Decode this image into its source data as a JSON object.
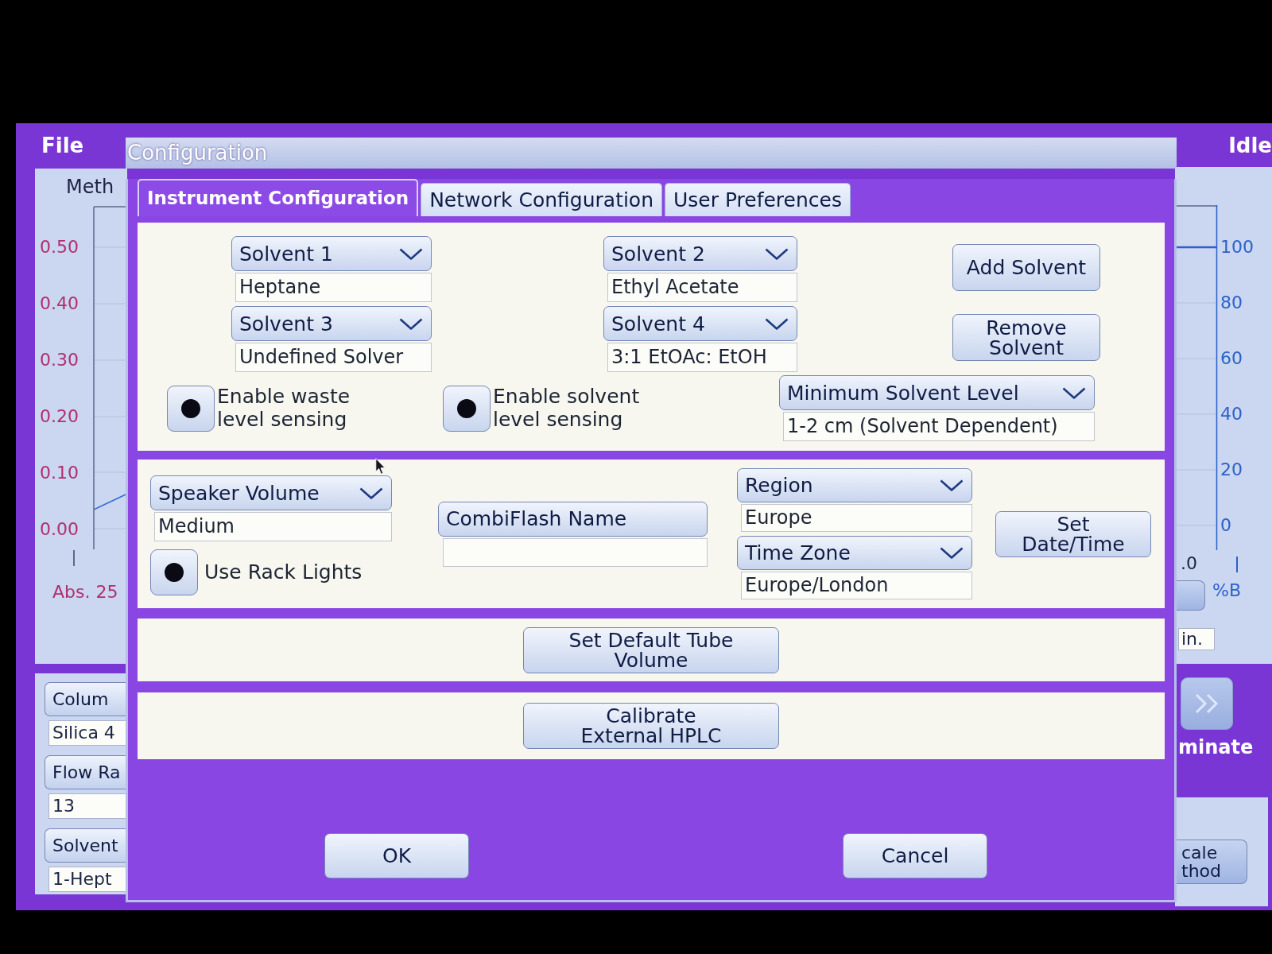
{
  "background_app": {
    "menu_label": "File",
    "status": "Idle",
    "chart": {
      "title": "Meth",
      "left_axis_labels": [
        "0.50",
        "0.40",
        "0.30",
        "0.20",
        "0.10",
        "0.00"
      ],
      "left_axis_title": "Abs. 25",
      "right_axis_labels": [
        "100",
        "80",
        "60",
        "40",
        "20",
        "0"
      ],
      "x_axis_label": ".0",
      "right_axis_title": "%B"
    },
    "settings": [
      {
        "label": "Colum",
        "value": "Silica 4"
      },
      {
        "label": "Flow Ra",
        "value": "13"
      },
      {
        "label": "Solvent",
        "value": "1-Hept"
      }
    ],
    "side_field": "in.",
    "action_label": "minate",
    "side_button": "cale thod"
  },
  "dialog": {
    "title": "Configuration",
    "tabs": [
      {
        "label": "Instrument Configuration",
        "selected": true
      },
      {
        "label": "Network Configuration",
        "selected": false
      },
      {
        "label": "User Preferences",
        "selected": false
      }
    ],
    "solvents": [
      {
        "label": "Solvent 1",
        "value": "Heptane"
      },
      {
        "label": "Solvent 2",
        "value": "Ethyl Acetate"
      },
      {
        "label": "Solvent 3",
        "value": "Undefined Solver"
      },
      {
        "label": "Solvent 4",
        "value": "3:1 EtOAc: EtOH"
      }
    ],
    "solvent_buttons": [
      "Add Solvent",
      "Remove Solvent"
    ],
    "sensing_options": [
      {
        "label": "Enable waste level sensing",
        "checked": true
      },
      {
        "label": "Enable solvent level sensing",
        "checked": true
      }
    ],
    "minimum_solvent_level": {
      "label": "Minimum Solvent Level",
      "value": "1-2 cm (Solvent Dependent)"
    },
    "speaker_volume": {
      "label": "Speaker Volume",
      "value": "Medium"
    },
    "rack_lights": {
      "label": "Use Rack Lights",
      "checked": true
    },
    "combiflash_name": {
      "label": "CombiFlash Name"
    },
    "region": {
      "label": "Region",
      "value": "Europe"
    },
    "time_zone": {
      "label": "Time Zone",
      "value": "Europe/London"
    },
    "date_time_button": "Set Date/Time",
    "tube_volume_button": "Set Default Tube Volume",
    "hplc_button": "Calibrate External HPLC",
    "footer_buttons": [
      "OK",
      "Cancel"
    ]
  }
}
